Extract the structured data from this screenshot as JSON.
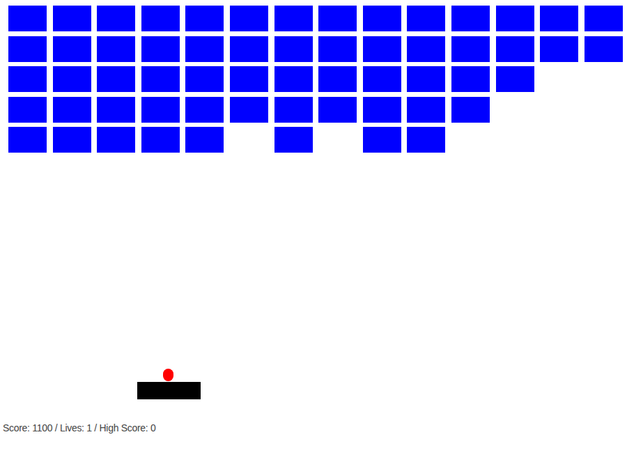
{
  "bricks": [
    [
      {
        "present": true
      },
      {
        "present": true
      },
      {
        "present": true
      },
      {
        "present": true
      },
      {
        "present": true
      },
      {
        "present": true
      },
      {
        "present": true
      },
      {
        "present": true
      },
      {
        "present": true
      },
      {
        "present": true
      },
      {
        "present": true
      },
      {
        "present": true
      },
      {
        "present": true
      },
      {
        "present": true
      }
    ],
    [
      {
        "present": true
      },
      {
        "present": true
      },
      {
        "present": true
      },
      {
        "present": true
      },
      {
        "present": true
      },
      {
        "present": true
      },
      {
        "present": true
      },
      {
        "present": true
      },
      {
        "present": true
      },
      {
        "present": true
      },
      {
        "present": true
      },
      {
        "present": true
      },
      {
        "present": true
      },
      {
        "present": true
      }
    ],
    [
      {
        "present": true
      },
      {
        "present": true
      },
      {
        "present": true
      },
      {
        "present": true
      },
      {
        "present": true
      },
      {
        "present": true
      },
      {
        "present": true
      },
      {
        "present": true
      },
      {
        "present": true
      },
      {
        "present": true
      },
      {
        "present": true
      },
      {
        "present": true
      },
      {
        "present": false
      },
      {
        "present": false
      }
    ],
    [
      {
        "present": true
      },
      {
        "present": true
      },
      {
        "present": true
      },
      {
        "present": true
      },
      {
        "present": true
      },
      {
        "present": true
      },
      {
        "present": true
      },
      {
        "present": true
      },
      {
        "present": true
      },
      {
        "present": true
      },
      {
        "present": true
      },
      {
        "present": false
      },
      {
        "present": false
      },
      {
        "present": false
      }
    ],
    [
      {
        "present": true
      },
      {
        "present": true
      },
      {
        "present": true
      },
      {
        "present": true
      },
      {
        "present": true
      },
      {
        "present": false
      },
      {
        "present": true
      },
      {
        "present": false
      },
      {
        "present": true
      },
      {
        "present": true
      },
      {
        "present": false
      },
      {
        "present": false
      },
      {
        "present": false
      },
      {
        "present": false
      }
    ]
  ],
  "status": "Score: 1100 / Lives: 1 / High Score: 0"
}
